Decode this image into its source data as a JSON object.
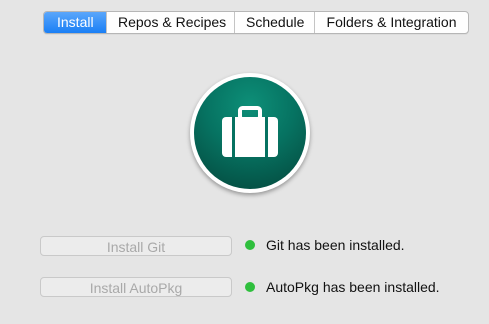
{
  "tabs": [
    {
      "label": "Install",
      "active": true
    },
    {
      "label": "Repos & Recipes",
      "active": false
    },
    {
      "label": "Schedule",
      "active": false
    },
    {
      "label": "Folders & Integration",
      "active": false
    }
  ],
  "icon": {
    "name": "briefcase-icon",
    "color": "#067261"
  },
  "install_git": {
    "button_label": "Install Git",
    "status_text": "Git has been installed.",
    "status_color": "#2fbf3d"
  },
  "install_autopkg": {
    "button_label": "Install AutoPkg",
    "status_text": "AutoPkg has been installed.",
    "status_color": "#2fbf3d"
  }
}
